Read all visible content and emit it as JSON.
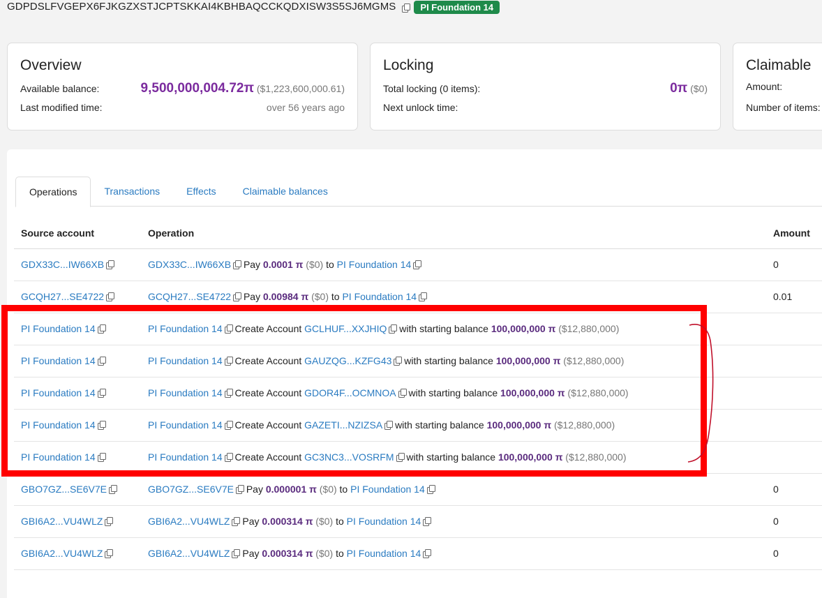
{
  "header": {
    "account_id": "GDPDSLFVGEPX6FJKGZXSTJCPTSKKAI4KBHBAQCCKQDXISW3S5SJ6MGMS",
    "badge": "PI Foundation 14"
  },
  "overview": {
    "title": "Overview",
    "available_label": "Available balance:",
    "available_value": "9,500,000,004.72π",
    "available_usd": "($1,223,600,000.61)",
    "modified_label": "Last modified time:",
    "modified_value": "over 56 years ago"
  },
  "locking": {
    "title": "Locking",
    "total_label": "Total locking (0 items):",
    "total_value": "0π",
    "total_usd": "($0)",
    "next_label": "Next unlock time:"
  },
  "claimable": {
    "title": "Claimable",
    "amount_label": "Amount:",
    "items_label": "Number of items:"
  },
  "tabs": [
    "Operations",
    "Transactions",
    "Effects",
    "Claimable balances"
  ],
  "table": {
    "headers": {
      "source": "Source account",
      "operation": "Operation",
      "amount": "Amount"
    },
    "rows": [
      {
        "source": "GDX33C...IW66XB",
        "op_account": "GDX33C...IW66XB",
        "type": "Pay",
        "value": "0.0001",
        "usd": "($0)",
        "to": "PI Foundation 14",
        "amount": "0"
      },
      {
        "source": "GCQH27...SE4722",
        "op_account": "GCQH27...SE4722",
        "type": "Pay",
        "value": "0.00984",
        "usd": "($0)",
        "to": "PI Foundation 14",
        "amount": "0.01"
      },
      {
        "source": "PI Foundation 14",
        "op_account": "PI Foundation 14",
        "type": "Create Account",
        "target": "GCLHUF...XXJHIQ",
        "balance": "100,000,000",
        "usd": "($12,880,000)",
        "amount": ""
      },
      {
        "source": "PI Foundation 14",
        "op_account": "PI Foundation 14",
        "type": "Create Account",
        "target": "GAUZQG...KZFG43",
        "balance": "100,000,000",
        "usd": "($12,880,000)",
        "amount": ""
      },
      {
        "source": "PI Foundation 14",
        "op_account": "PI Foundation 14",
        "type": "Create Account",
        "target": "GDOR4F...OCMNOA",
        "balance": "100,000,000",
        "usd": "($12,880,000)",
        "amount": ""
      },
      {
        "source": "PI Foundation 14",
        "op_account": "PI Foundation 14",
        "type": "Create Account",
        "target": "GAZETI...NZIZSA",
        "balance": "100,000,000",
        "usd": "($12,880,000)",
        "amount": ""
      },
      {
        "source": "PI Foundation 14",
        "op_account": "PI Foundation 14",
        "type": "Create Account",
        "target": "GC3NC3...VOSRFM",
        "balance": "100,000,000",
        "usd": "($12,880,000)",
        "amount": ""
      },
      {
        "source": "GBO7GZ...SE6V7E",
        "op_account": "GBO7GZ...SE6V7E",
        "type": "Pay",
        "value": "0.000001",
        "usd": "($0)",
        "to": "PI Foundation 14",
        "amount": "0"
      },
      {
        "source": "GBI6A2...VU4WLZ",
        "op_account": "GBI6A2...VU4WLZ",
        "type": "Pay",
        "value": "0.000314",
        "usd": "($0)",
        "to": "PI Foundation 14",
        "amount": "0"
      },
      {
        "source": "GBI6A2...VU4WLZ",
        "op_account": "GBI6A2...VU4WLZ",
        "type": "Pay",
        "value": "0.000314",
        "usd": "($0)",
        "to": "PI Foundation 14",
        "amount": "0"
      }
    ],
    "phrases": {
      "to": "to",
      "with_balance": "with starting balance",
      "pi": "π"
    }
  },
  "colors": {
    "accent": "#2a7bc1",
    "badge": "#1e8a4a",
    "pi_amount": "#7b2b9e",
    "highlight": "#ff0000"
  }
}
